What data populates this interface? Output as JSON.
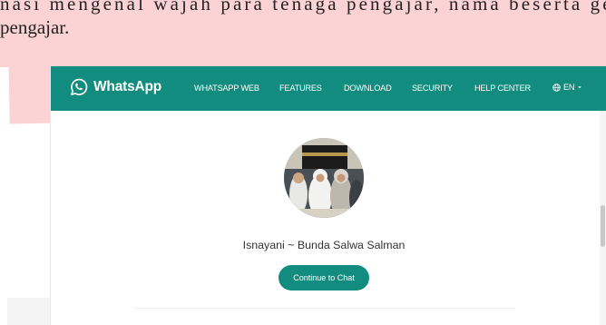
{
  "document": {
    "line1": "nasi mengenal wajah para tenaga pengajar, nama beserta ge",
    "line2": "pengajar."
  },
  "header": {
    "logo_text": "WhatsApp",
    "nav": [
      "WHATSAPP WEB",
      "FEATURES",
      "DOWNLOAD",
      "SECURITY",
      "HELP CENTER"
    ],
    "language": "EN"
  },
  "contact": {
    "name": "Isnayani ~ Bunda Salwa Salman"
  },
  "actions": {
    "continue_label": "Continue to Chat"
  },
  "colors": {
    "brand": "#128c7e",
    "highlight": "#fcd3d5"
  },
  "icons": [
    "whatsapp-logo-icon",
    "globe-icon",
    "caret-down-icon"
  ]
}
